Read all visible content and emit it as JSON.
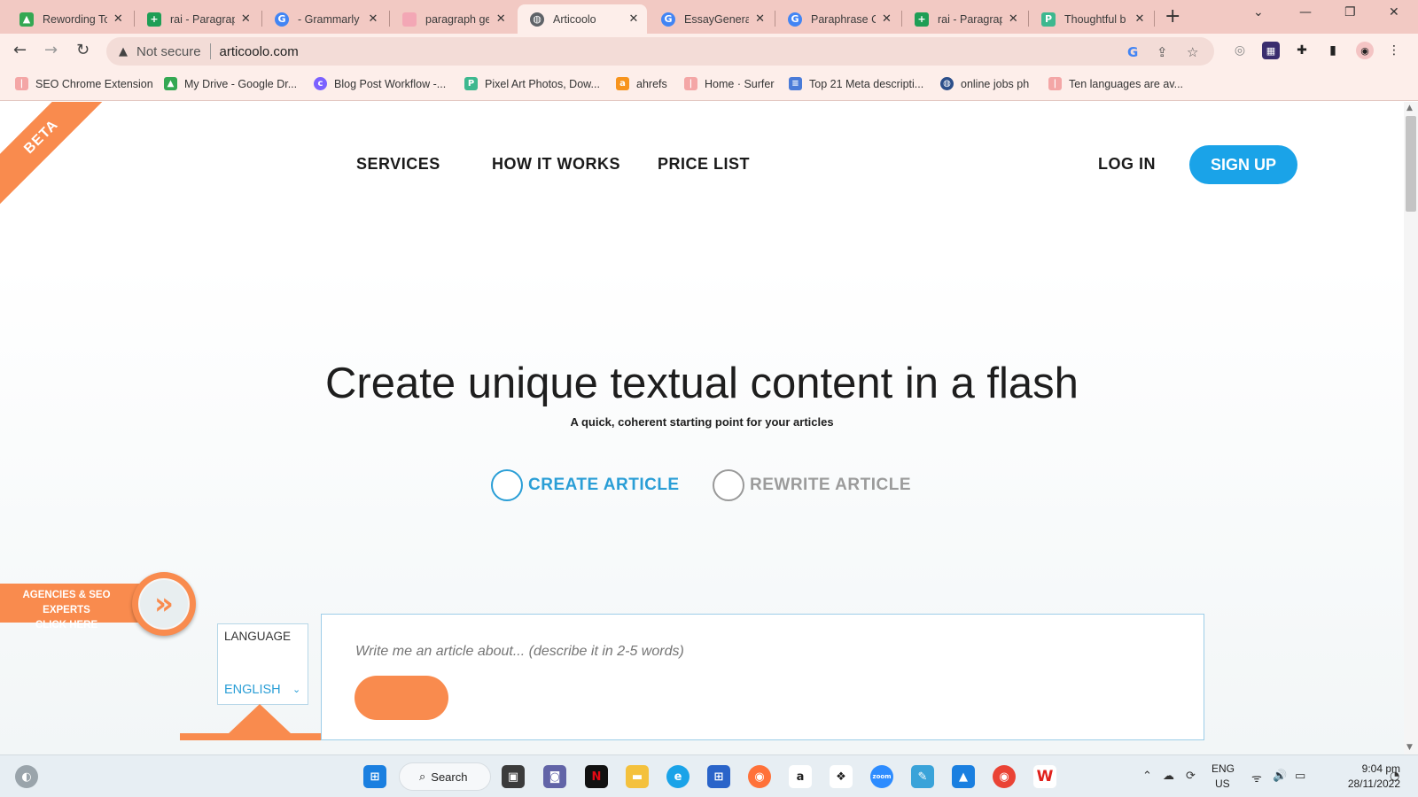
{
  "browser": {
    "tabs": [
      {
        "title": "Rewording To",
        "icon": "google-drive-icon",
        "color": "#34a853"
      },
      {
        "title": "rai - Paragrap",
        "icon": "google-sheets-icon",
        "color": "#1e9e55"
      },
      {
        "title": "- Grammarly",
        "icon": "google-icon",
        "color": "#4285f4"
      },
      {
        "title": "paragraph ge",
        "icon": "page-icon",
        "color": "#f3a7b5"
      },
      {
        "title": "Articoolo",
        "icon": "globe-icon",
        "color": "#5f6368"
      },
      {
        "title": "EssayGenerat",
        "icon": "google-icon",
        "color": "#4285f4"
      },
      {
        "title": "Paraphrase C",
        "icon": "google-icon",
        "color": "#4285f4"
      },
      {
        "title": "rai - Paragrap",
        "icon": "google-sheets-icon",
        "color": "#1e9e55"
      },
      {
        "title": "Thoughtful b",
        "icon": "paraphraser-icon",
        "color": "#3db88f"
      }
    ],
    "new_tab": "+",
    "address": {
      "security": "Not secure",
      "url": "articoolo.com"
    },
    "bookmarks": [
      {
        "label": "SEO Chrome Extension",
        "color": "#f4a6a6"
      },
      {
        "label": "My Drive - Google Dr...",
        "color": "#34a853"
      },
      {
        "label": "Blog Post Workflow -...",
        "color": "#7b61ff"
      },
      {
        "label": "Pixel Art Photos, Dow...",
        "color": "#3db88f"
      },
      {
        "label": "ahrefs",
        "color": "#f7941d"
      },
      {
        "label": "Home · Surfer",
        "color": "#f4a6a6"
      },
      {
        "label": "Top 21 Meta descripti...",
        "color": "#4a7bd8"
      },
      {
        "label": "online jobs ph",
        "color": "#2c4f8a"
      },
      {
        "label": "Ten languages are av...",
        "color": "#f4a6a6"
      }
    ]
  },
  "site": {
    "badge": "BETA",
    "nav": {
      "services": "SERVICES",
      "how": "HOW IT WORKS",
      "price": "PRICE LIST",
      "login": "LOG IN",
      "signup": "SIGN UP"
    },
    "hero": {
      "title": "Create unique textual content in a flash",
      "subtitle": "A quick, coherent starting point for your articles"
    },
    "modes": {
      "create": "CREATE ARTICLE",
      "rewrite": "REWRITE ARTICLE"
    },
    "agency": {
      "line1": "AGENCIES & SEO EXPERTS",
      "line2": "CLICK HERE"
    },
    "language": {
      "caption": "LANGUAGE",
      "value": "ENGLISH"
    },
    "article": {
      "placeholder": "Write me an article about... (describe it in 2-5 words)"
    },
    "colors": {
      "accent_blue": "#1aa3e8",
      "accent_orange": "#f98b4e"
    }
  },
  "taskbar": {
    "search": "Search",
    "language": "ENG",
    "region": "US",
    "time": "9:04 pm",
    "date": "28/11/2022"
  }
}
